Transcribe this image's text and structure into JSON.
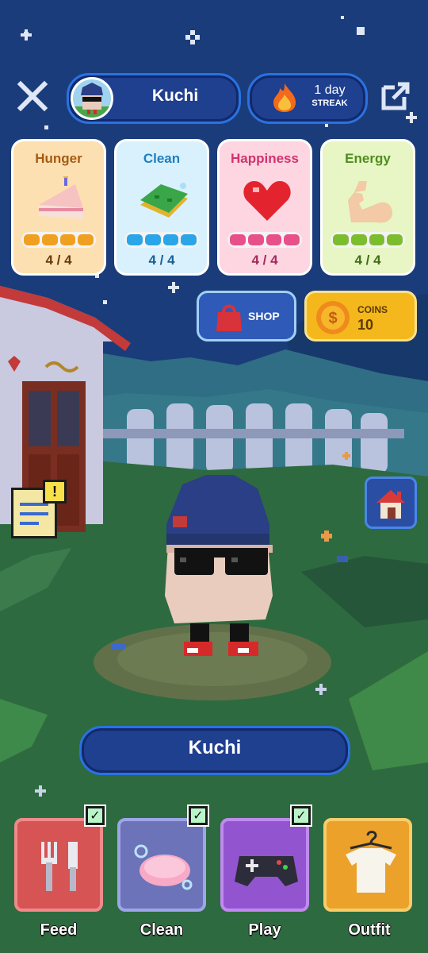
{
  "header": {
    "pet_name": "Kuchi",
    "streak_value": "1 day",
    "streak_label": "STREAK"
  },
  "stats": [
    {
      "name": "Hunger",
      "value": "4 / 4",
      "level": 1.0,
      "icon": "cake-icon",
      "color": "#f0a020"
    },
    {
      "name": "Clean",
      "value": "4 / 4",
      "level": 1.0,
      "icon": "sponge-icon",
      "color": "#2aa6e8"
    },
    {
      "name": "Happiness",
      "value": "4 / 4",
      "level": 1.0,
      "icon": "heart-icon",
      "color": "#e8508a"
    },
    {
      "name": "Energy",
      "value": "4 / 4",
      "level": 1.0,
      "icon": "flexed-arm-icon",
      "color": "#7cbd2e"
    }
  ],
  "shop": {
    "label": "SHOP"
  },
  "coins": {
    "label": "COINS",
    "value": "10"
  },
  "nameplate": {
    "name": "Kuchi"
  },
  "actions": [
    {
      "label": "Feed",
      "done": true
    },
    {
      "label": "Clean",
      "done": true
    },
    {
      "label": "Play",
      "done": true
    },
    {
      "label": "Outfit",
      "done": false
    }
  ],
  "checkmark": "✓",
  "notice_badge": "!",
  "colors": {
    "sky": "#193b78",
    "grass": "#2f6a3e",
    "accent_blue": "#2a72e0",
    "coin_gold": "#f4b81c"
  }
}
